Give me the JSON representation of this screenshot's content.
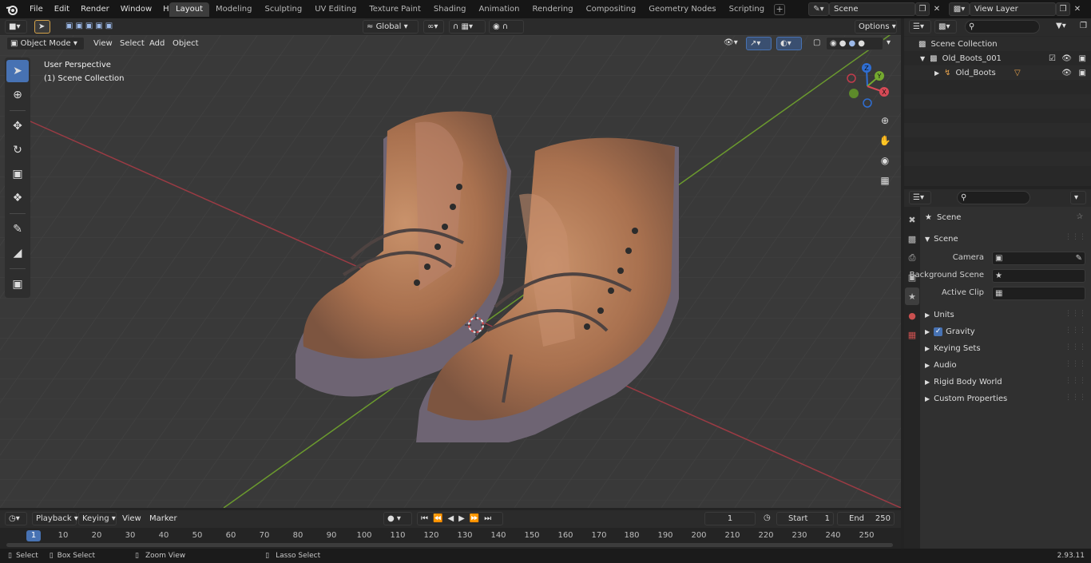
{
  "menubar": {
    "items": [
      "File",
      "Edit",
      "Render",
      "Window",
      "Help"
    ]
  },
  "workspaces": {
    "tabs": [
      "Layout",
      "Modeling",
      "Sculpting",
      "UV Editing",
      "Texture Paint",
      "Shading",
      "Animation",
      "Rendering",
      "Compositing",
      "Geometry Nodes",
      "Scripting"
    ],
    "active": "Layout"
  },
  "scene_selector": {
    "value": "Scene"
  },
  "view_layer_selector": {
    "value": "View Layer"
  },
  "viewport_header": {
    "mode": "Object Mode",
    "menus": [
      "View",
      "Select",
      "Add",
      "Object"
    ],
    "orientation": "Global",
    "options": "Options"
  },
  "viewport_overlay": {
    "perspective": "User Perspective",
    "collection": "(1) Scene Collection"
  },
  "gizmo": {
    "z": "Z",
    "y": "Y",
    "x": "X"
  },
  "outliner": {
    "rows": [
      {
        "label": "Scene Collection"
      },
      {
        "label": "Old_Boots_001"
      },
      {
        "label": "Old_Boots"
      }
    ]
  },
  "properties": {
    "header": "Scene",
    "panel_title": "Scene",
    "fields": [
      {
        "label": "Camera",
        "value": ""
      },
      {
        "label": "Background Scene",
        "value": ""
      },
      {
        "label": "Active Clip",
        "value": ""
      }
    ],
    "sections": [
      "Units",
      "Gravity",
      "Keying Sets",
      "Audio",
      "Rigid Body World",
      "Custom Properties"
    ],
    "gravity_checked": true
  },
  "timeline": {
    "menus": [
      "Playback",
      "Keying",
      "View",
      "Marker"
    ],
    "current_frame": "1",
    "start_label": "Start",
    "start_value": "1",
    "end_label": "End",
    "end_value": "250",
    "ruler": [
      "1",
      "10",
      "20",
      "30",
      "40",
      "50",
      "60",
      "70",
      "80",
      "90",
      "100",
      "110",
      "120",
      "130",
      "140",
      "150",
      "160",
      "170",
      "180",
      "190",
      "200",
      "210",
      "220",
      "230",
      "240",
      "250"
    ]
  },
  "statusbar": {
    "select": "Select",
    "box_select": "Box Select",
    "zoom_view": "Zoom View",
    "lasso_select": "Lasso Select",
    "version": "2.93.11"
  }
}
